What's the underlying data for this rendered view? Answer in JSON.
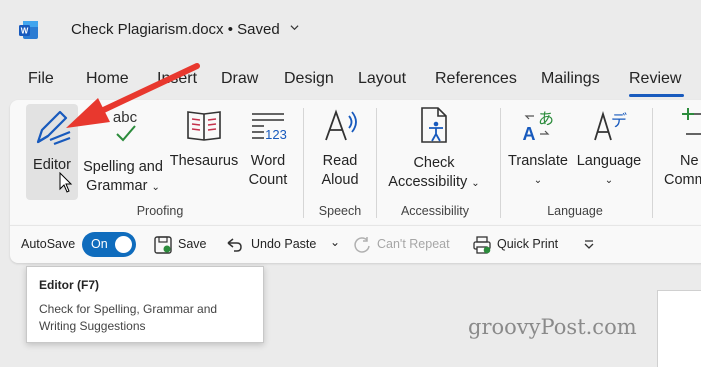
{
  "titlebar": {
    "doc_title": "Check Plagiarism.docx • Saved"
  },
  "tabs": [
    "File",
    "Home",
    "Insert",
    "Draw",
    "Design",
    "Layout",
    "References",
    "Mailings",
    "Review"
  ],
  "ribbon": {
    "proofing": {
      "editor": "Editor",
      "spelling_1": "Spelling and",
      "spelling_2": "Grammar",
      "thesaurus": "Thesaurus",
      "wordcount_1": "Word",
      "wordcount_2": "Count",
      "label": "Proofing"
    },
    "speech": {
      "read_1": "Read",
      "read_2": "Aloud",
      "label": "Speech"
    },
    "accessibility": {
      "check_1": "Check",
      "check_2": "Accessibility",
      "label": "Accessibility"
    },
    "language": {
      "translate": "Translate",
      "language": "Language",
      "label": "Language"
    },
    "comments": {
      "new_1": "Ne",
      "new_2": "Comm"
    }
  },
  "qat": {
    "autosave": "AutoSave",
    "toggle": "On",
    "save": "Save",
    "undo": "Undo Paste",
    "repeat": "Can't Repeat",
    "quickprint": "Quick Print"
  },
  "tooltip": {
    "title": "Editor (F7)",
    "desc": "Check for Spelling, Grammar and Writing Suggestions"
  },
  "watermark": "groovyPost.com",
  "colors": {
    "accent": "#185abd",
    "toggle": "#0f6cbd",
    "arrow": "#e8382e"
  }
}
